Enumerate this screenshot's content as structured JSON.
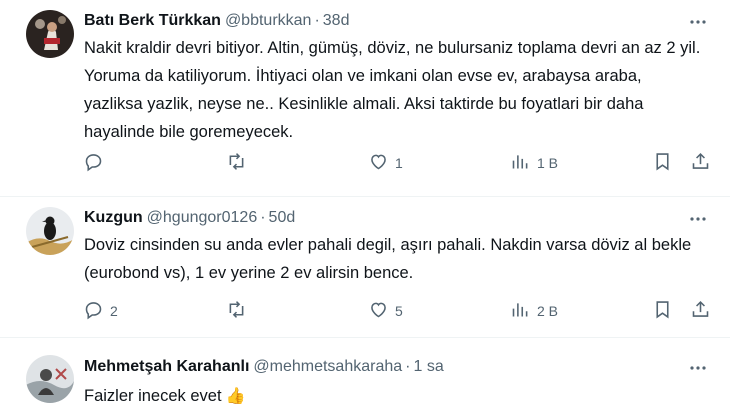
{
  "tweets": [
    {
      "name": "Batı Berk Türkkan",
      "handle": "@bbturkkan",
      "dot": "·",
      "time": "38d",
      "text": "Nakit kraldir devri bitiyor. Altin, gümüş, döviz, ne bulursaniz toplama devri an az 2 yil. Yoruma da katiliyorum. İhtiyaci olan ve imkani olan evse ev, arabaysa araba, yazliksa yazlik, neyse ne.. Kesinlikle almali. Aksi taktirde bu foyatlari bir daha hayalinde bile goremeyecek.",
      "reply_count": "",
      "retweet_count": "",
      "like_count": "1",
      "views_count": "1 B"
    },
    {
      "name": "Kuzgun",
      "handle": "@hgungor0126",
      "dot": "·",
      "time": "50d",
      "text": "Doviz cinsinden su anda evler pahali degil, aşırı pahali. Nakdin varsa döviz al bekle (eurobond vs), 1 ev yerine 2 ev alirsin bence.",
      "reply_count": "2",
      "retweet_count": "",
      "like_count": "5",
      "views_count": "2 B"
    },
    {
      "name": "Mehmetşah Karahanlı",
      "handle": "@mehmetsahkaraha",
      "dot": "·",
      "time": "1 sa",
      "text": "Faizler inecek evet",
      "emoji": "👍"
    }
  ],
  "icons": {
    "more": "more-icon",
    "reply": "reply-icon",
    "retweet": "retweet-icon",
    "like": "heart-icon",
    "views": "views-icon",
    "bookmark": "bookmark-icon",
    "share": "share-icon"
  },
  "colors": {
    "text": "#0f1419",
    "secondary": "#536471",
    "divider": "#eff3f4"
  }
}
